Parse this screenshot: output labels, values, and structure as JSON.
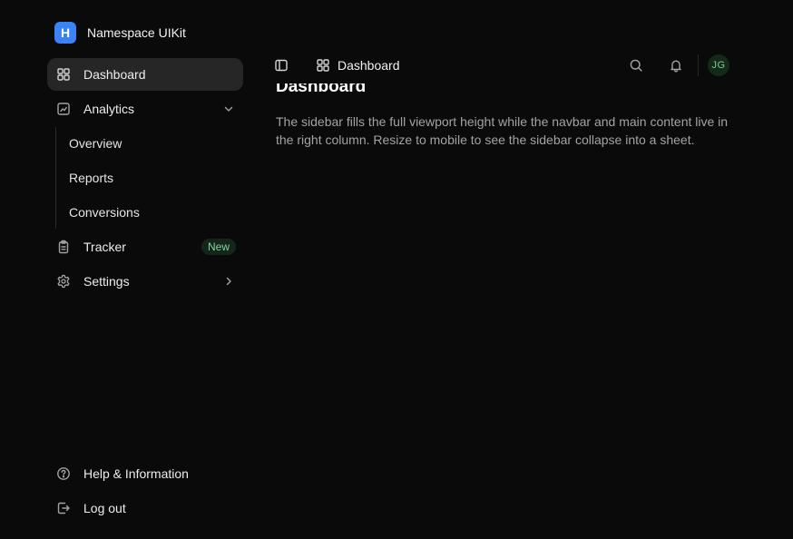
{
  "brand": {
    "logo_letter": "H",
    "name": "Namespace UIKit",
    "accent": "#3b82f6"
  },
  "sidebar": {
    "items": [
      {
        "label": "Dashboard",
        "icon": "grid-icon",
        "active": true
      },
      {
        "label": "Analytics",
        "icon": "analytics-icon",
        "expanded": true
      },
      {
        "label": "Tracker",
        "icon": "clipboard-icon",
        "badge": "New"
      },
      {
        "label": "Settings",
        "icon": "gear-icon"
      }
    ],
    "analytics_children": [
      "Overview",
      "Reports",
      "Conversions"
    ],
    "footer": [
      {
        "label": "Help & Information",
        "icon": "help-circle-icon"
      },
      {
        "label": "Log out",
        "icon": "logout-icon"
      }
    ]
  },
  "navbar": {
    "breadcrumb": "Dashboard",
    "avatar_initials": "JG"
  },
  "main": {
    "title": "Dashboard",
    "description": "The sidebar fills the full viewport height while the navbar and main content live in the right column. Resize to mobile to see the sidebar collapse into a sheet."
  }
}
